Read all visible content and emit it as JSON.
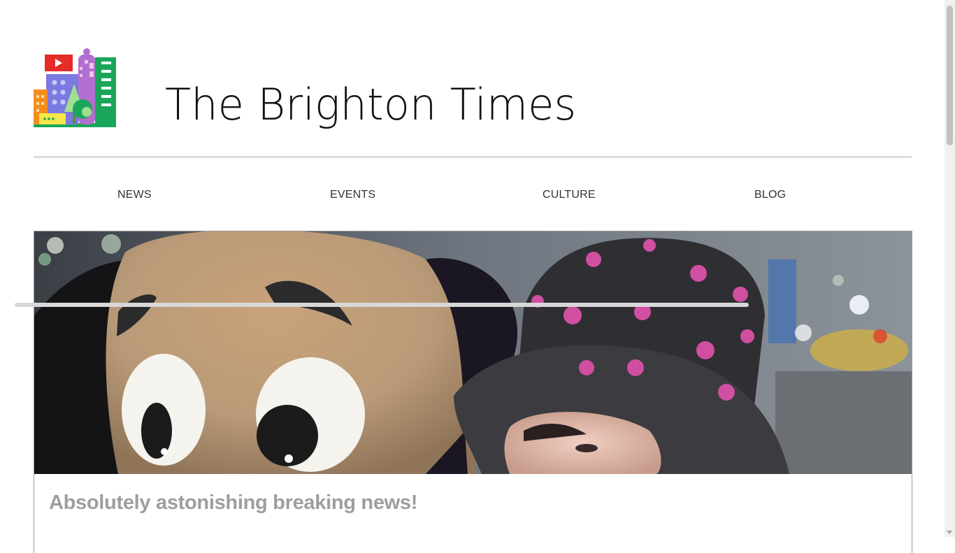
{
  "site": {
    "title": "The Brighton Times"
  },
  "nav": {
    "items": [
      {
        "label": "NEWS"
      },
      {
        "label": "EVENTS"
      },
      {
        "label": "CULTURE"
      },
      {
        "label": "BLOG"
      }
    ]
  },
  "article": {
    "headline": "Absolutely astonishing breaking news!",
    "hero_alt": "Person in skull-print hat beside a plush bear costume at night"
  },
  "colors": {
    "rule": "#dcdcdc",
    "headline": "#9e9e9e",
    "card_border": "#9e9e9e"
  }
}
